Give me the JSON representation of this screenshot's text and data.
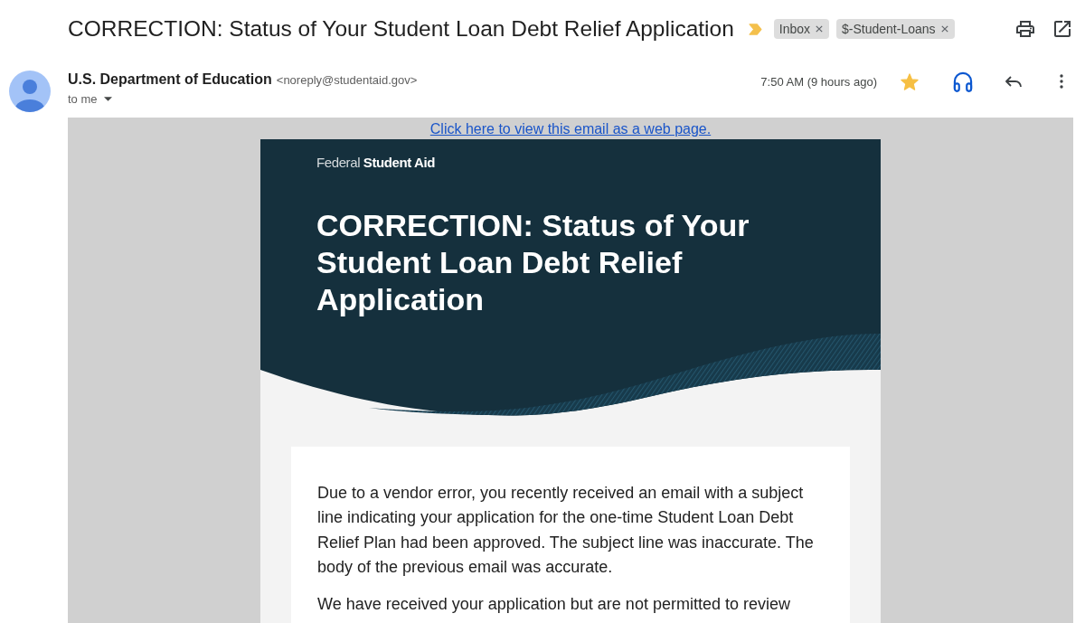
{
  "subject": {
    "title": "CORRECTION: Status of Your Student Loan Debt Relief Application",
    "important": true,
    "labels": [
      {
        "name": "Inbox"
      },
      {
        "name": "$-Student-Loans"
      }
    ]
  },
  "sender": {
    "name": "U.S. Department of Education",
    "email": "<noreply@studentaid.gov>",
    "recipient": "to me"
  },
  "message": {
    "time": "7:50 AM (9 hours ago)",
    "starred": true
  },
  "email": {
    "web_link": "Click here to view this email as a web page.",
    "logo": "Federal **Student Aid**",
    "heading": "CORRECTION: Status of Your Student Loan Debt Relief Application",
    "paragraphs": [
      "Due to a vendor error, you recently received an email with a subject line indicating your application for the one-time Student Loan Debt Relief Plan had been approved. The subject line was inaccurate. The body of the previous email was accurate.",
      "We have received your application but are not permitted to review"
    ]
  }
}
